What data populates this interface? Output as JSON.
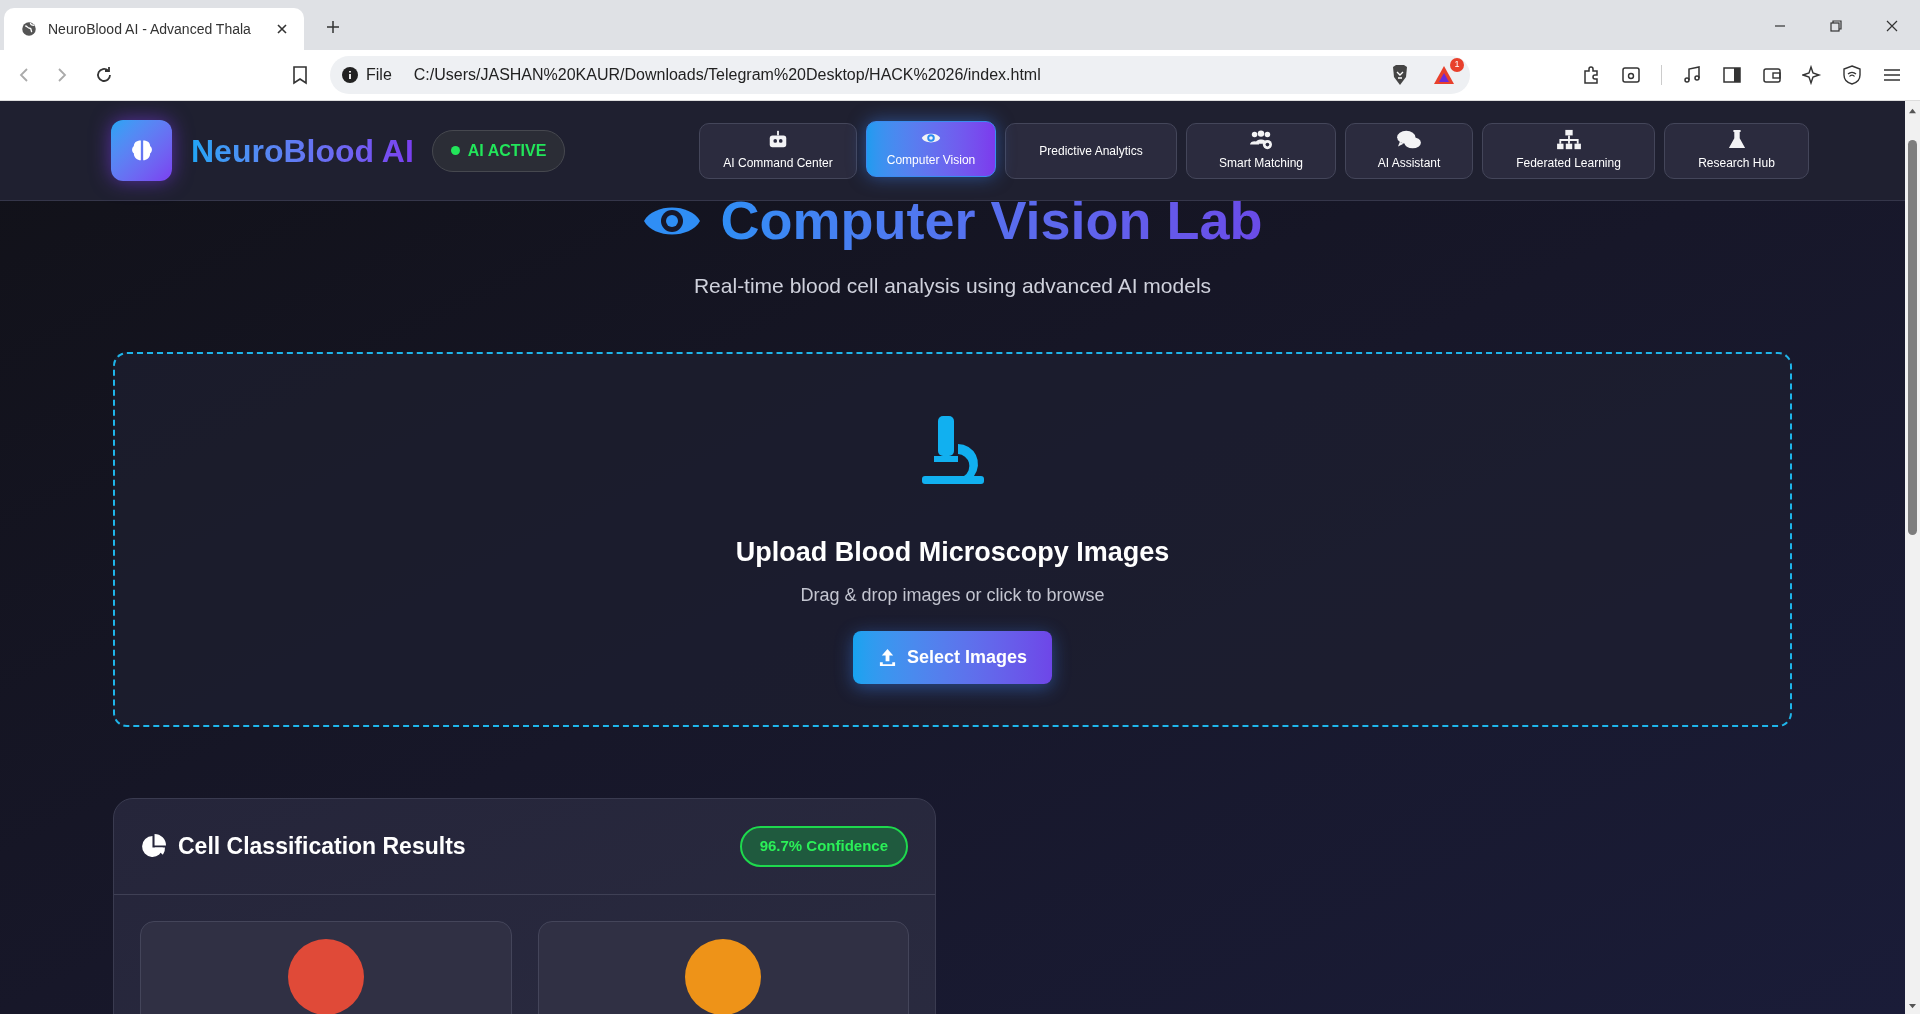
{
  "browser": {
    "tab_title": "NeuroBlood AI - Advanced Thala",
    "address_scheme": "File",
    "url": "C:/Users/JASHAN%20KAUR/Downloads/Telegram%20Desktop/HACK%2026/index.html",
    "shield_badge": "1"
  },
  "header": {
    "brand": "NeuroBlood AI",
    "status": "AI ACTIVE",
    "nav": [
      {
        "label": "AI Command Center",
        "selected": false
      },
      {
        "label": "Computer Vision",
        "selected": true
      },
      {
        "label": "Predictive Analytics",
        "selected": false
      },
      {
        "label": "Smart Matching",
        "selected": false
      },
      {
        "label": "AI Assistant",
        "selected": false
      },
      {
        "label": "Federated Learning",
        "selected": false
      },
      {
        "label": "Research Hub",
        "selected": false
      }
    ]
  },
  "page": {
    "title": "Computer Vision Lab",
    "subtitle": "Real-time blood cell analysis using advanced AI models"
  },
  "upload": {
    "heading": "Upload Blood Microscopy Images",
    "hint": "Drag & drop images or click to browse",
    "button": "Select Images"
  },
  "results": {
    "title": "Cell Classification Results",
    "badge": "96.7% Confidence",
    "cells": [
      {
        "color": "#e04a38"
      },
      {
        "color": "#ee9318"
      }
    ]
  }
}
